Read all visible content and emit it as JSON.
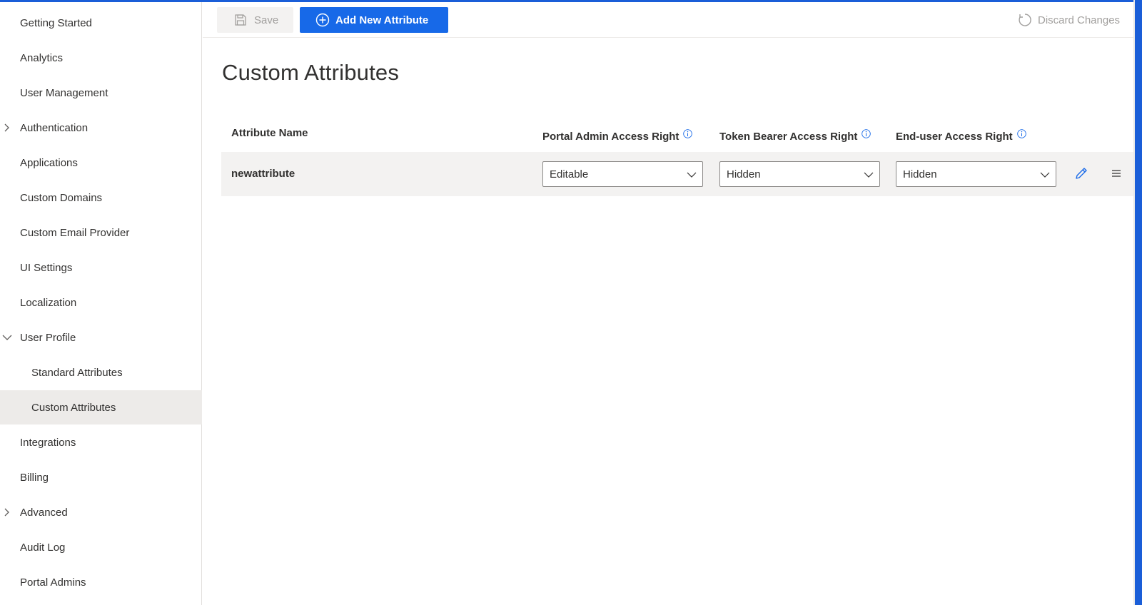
{
  "sidebar": {
    "items": [
      {
        "label": "Getting Started"
      },
      {
        "label": "Analytics"
      },
      {
        "label": "User Management"
      },
      {
        "label": "Authentication",
        "chevron": "chevron-right-icon"
      },
      {
        "label": "Applications"
      },
      {
        "label": "Custom Domains"
      },
      {
        "label": "Custom Email Provider"
      },
      {
        "label": "UI Settings"
      },
      {
        "label": "Localization"
      },
      {
        "label": "User Profile",
        "chevron": "chevron-down-icon"
      },
      {
        "label": "Standard Attributes"
      },
      {
        "label": "Custom Attributes",
        "selected": true
      },
      {
        "label": "Integrations"
      },
      {
        "label": "Billing"
      },
      {
        "label": "Advanced",
        "chevron": "chevron-right-icon"
      },
      {
        "label": "Audit Log"
      },
      {
        "label": "Portal Admins"
      }
    ]
  },
  "toolbar": {
    "save_label": "Save",
    "add_label": "Add New Attribute",
    "discard_label": "Discard Changes"
  },
  "main": {
    "title": "Custom Attributes",
    "columns": [
      {
        "label": "Attribute Name"
      },
      {
        "label": "Portal Admin Access Right",
        "info": true
      },
      {
        "label": "Token Bearer Access Right",
        "info": true
      },
      {
        "label": "End-user Access Right",
        "info": true
      }
    ],
    "rows": [
      {
        "name": "newattribute",
        "portal_admin": "Editable",
        "token_bearer": "Hidden",
        "end_user": "Hidden"
      }
    ]
  },
  "colors": {
    "accent": "#1769e8",
    "selected_bg": "#edebe9",
    "row_bg": "#f3f2f1",
    "disabled_text": "#a19f9d"
  }
}
